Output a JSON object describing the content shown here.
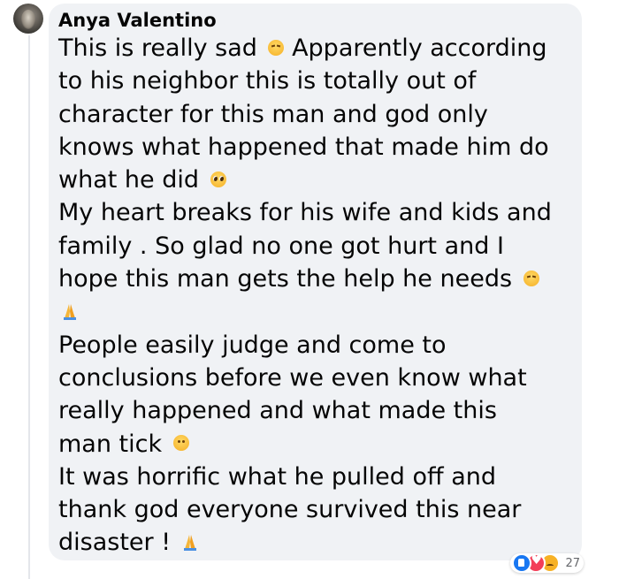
{
  "comment": {
    "author": "Anya Valentino",
    "lines": [
      "This is really sad",
      "Apparently according",
      "to his neighbor this is totally out of",
      "character for this man and god only",
      "knows what happened that made him do",
      "what he did",
      "My heart breaks for his wife and kids and",
      "family . So glad no one got hurt and I",
      "hope this man gets the help he needs",
      "People easily judge and come to",
      "conclusions before we even know what",
      "really happened and what made this",
      "man tick",
      "It was horrific what he pulled off and",
      "thank god everyone survived this near",
      "disaster !"
    ],
    "emojis": [
      "pensive-face",
      "pleading-face",
      "pensive-face",
      "folded-hands",
      "frowning-face",
      "folded-hands"
    ]
  },
  "reactions": {
    "types": [
      "like",
      "love",
      "sad"
    ],
    "count": "27"
  },
  "colors": {
    "bubble": "#f0f2f5",
    "text": "#050505",
    "like": "#1877f2",
    "love": "#f33e58",
    "sad": "#f7b125",
    "meta": "#65676b"
  }
}
